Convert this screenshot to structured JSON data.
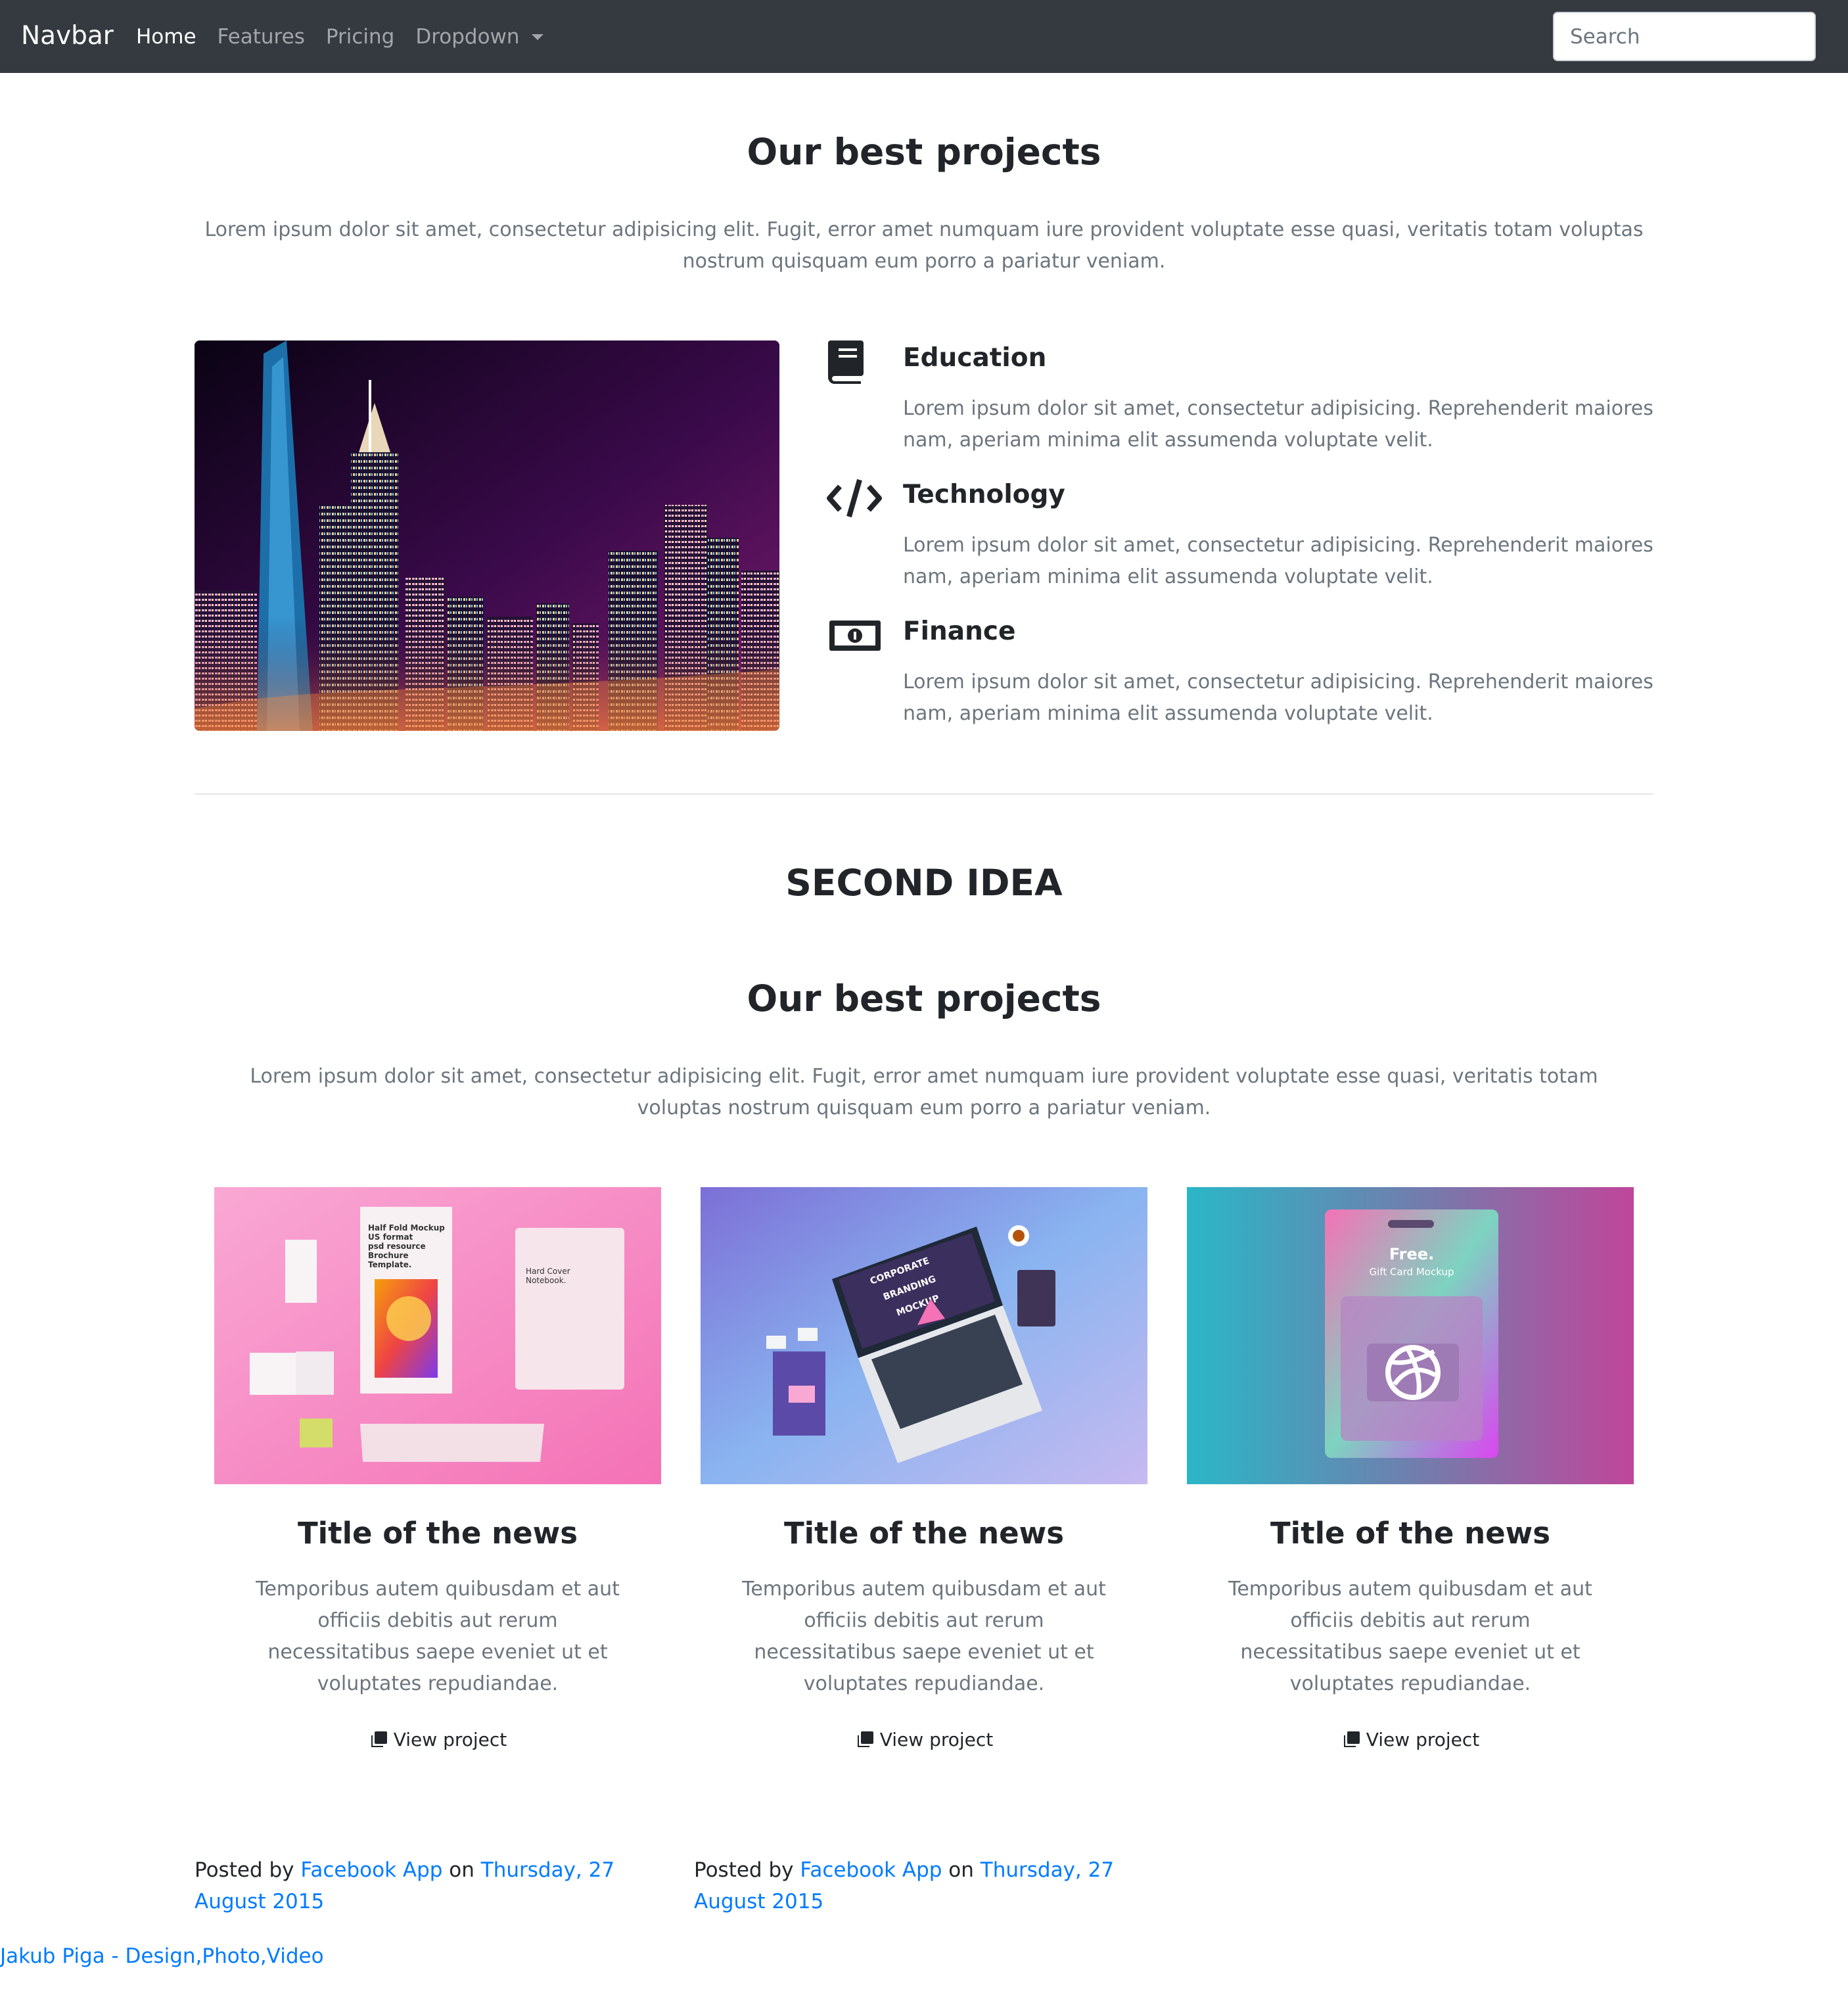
{
  "navbar": {
    "brand": "Navbar",
    "links": [
      {
        "label": "Home",
        "active": true
      },
      {
        "label": "Features",
        "active": false
      },
      {
        "label": "Pricing",
        "active": false
      },
      {
        "label": "Dropdown",
        "active": false
      }
    ],
    "search_placeholder": "Search"
  },
  "section1": {
    "title": "Our best projects",
    "lead": "Lorem ipsum dolor sit amet, consectetur adipisicing elit. Fugit, error amet numquam iure provident voluptate esse quasi, veritatis totam voluptas nostrum quisquam eum porro a pariatur veniam.",
    "features": [
      {
        "icon": "book-icon",
        "title": "Education",
        "text": "Lorem ipsum dolor sit amet, consectetur adipisicing. Reprehenderit maiores nam, aperiam minima elit assumenda voluptate velit."
      },
      {
        "icon": "code-icon",
        "title": "Technology",
        "text": "Lorem ipsum dolor sit amet, consectetur adipisicing. Reprehenderit maiores nam, aperiam minima elit assumenda voluptate velit."
      },
      {
        "icon": "money-bill-icon",
        "title": "Finance",
        "text": "Lorem ipsum dolor sit amet, consectetur adipisicing. Reprehenderit maiores nam, aperiam minima elit assumenda voluptate velit."
      }
    ]
  },
  "section2": {
    "heading": "SECOND IDEA",
    "title": "Our best projects",
    "lead": "Lorem ipsum dolor sit amet, consectetur adipisicing elit. Fugit, error amet numquam iure provident voluptate esse quasi, veritatis totam voluptas nostrum quisquam eum porro a pariatur veniam.",
    "cards": [
      {
        "title": "Title of the news",
        "text": "Temporibus autem quibusdam et aut officiis debitis aut rerum necessitatibus saepe eveniet ut et voluptates repudiandae.",
        "link": "View project",
        "mockup_text": [
          "Half Fold Mockup",
          "US format",
          "psd resource",
          "Brochure",
          "Template."
        ],
        "notebook_text": [
          "Hard Cover",
          "Notebook."
        ]
      },
      {
        "title": "Title of the news",
        "text": "Temporibus autem quibusdam et aut officiis debitis aut rerum necessitatibus saepe eveniet ut et voluptates repudiandae.",
        "link": "View project",
        "mockup_text": [
          "CORPORATE",
          "BRANDING",
          "MOCKUP"
        ]
      },
      {
        "title": "Title of the news",
        "text": "Temporibus autem quibusdam et aut officiis debitis aut rerum necessitatibus saepe eveniet ut et voluptates repudiandae.",
        "link": "View project",
        "mockup_text": [
          "Free.",
          "Gift Card Mockup"
        ]
      }
    ]
  },
  "posts": [
    {
      "prefix": "Posted by",
      "author": "Facebook App",
      "middle": "on",
      "date": "Thursday, 27 August 2015"
    },
    {
      "prefix": "Posted by",
      "author": "Facebook App",
      "middle": "on",
      "date": "Thursday, 27 August 2015"
    }
  ],
  "footer": {
    "link": "Jakub Piga - Design,Photo,Video"
  },
  "colors": {
    "navbar": "#343a40",
    "link": "#007bff",
    "muted": "#6c757d"
  }
}
